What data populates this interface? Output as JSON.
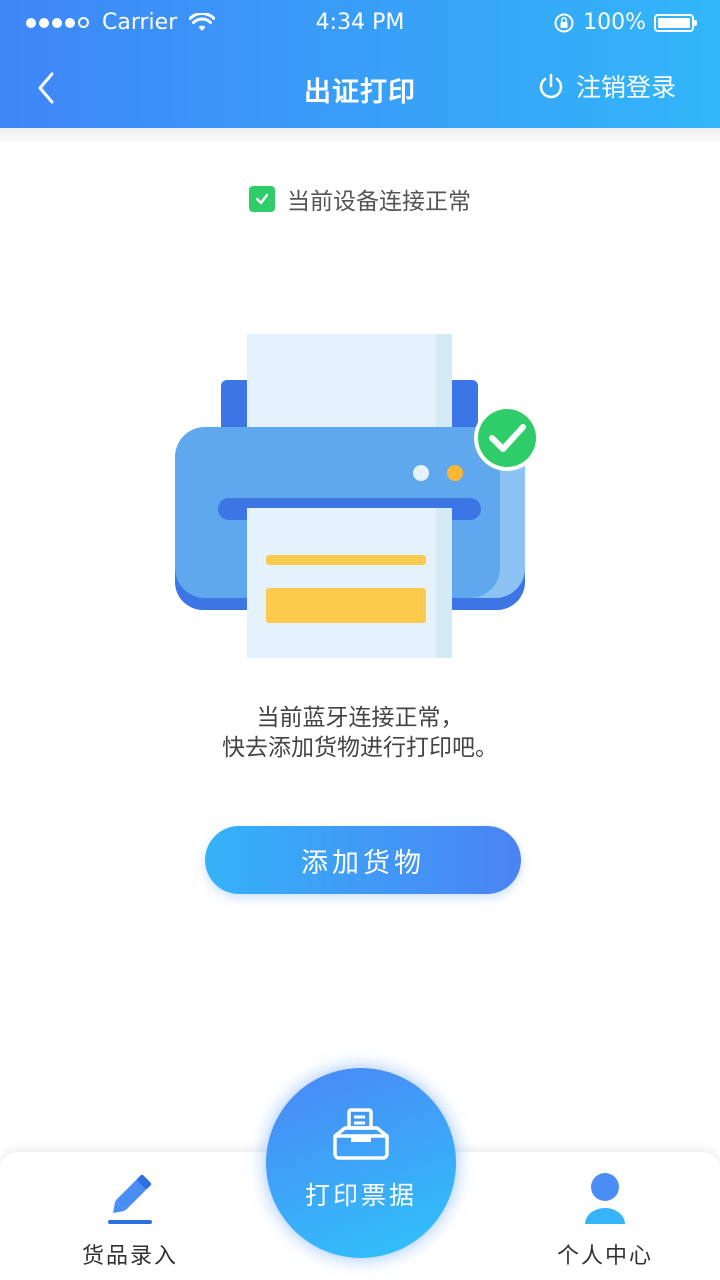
{
  "status_bar": {
    "carrier": "Carrier",
    "time": "4:34 PM",
    "battery": "100%"
  },
  "nav": {
    "title": "出证打印",
    "logout_label": "注销登录",
    "back_icon": "chevron-left-icon",
    "logout_icon": "power-icon"
  },
  "device_status": {
    "text": "当前设备连接正常",
    "icon": "checkbox-checked-icon"
  },
  "message": {
    "line1": "当前蓝牙连接正常，",
    "line2": "快去添加货物进行打印吧。"
  },
  "primary_button": {
    "label": "添加货物"
  },
  "tabbar": {
    "goods_entry": {
      "label": "货品录入",
      "icon": "pencil-icon"
    },
    "print_receipt": {
      "label": "打印票据",
      "icon": "printer-icon"
    },
    "personal_center": {
      "label": "个人中心",
      "icon": "user-icon"
    }
  },
  "colors": {
    "header_start": "#3f86f7",
    "header_end": "#32b6f9",
    "success_green": "#2fcd6a",
    "printer_blue": "#5fa8ee",
    "paper_yellow": "#fccb4e"
  }
}
